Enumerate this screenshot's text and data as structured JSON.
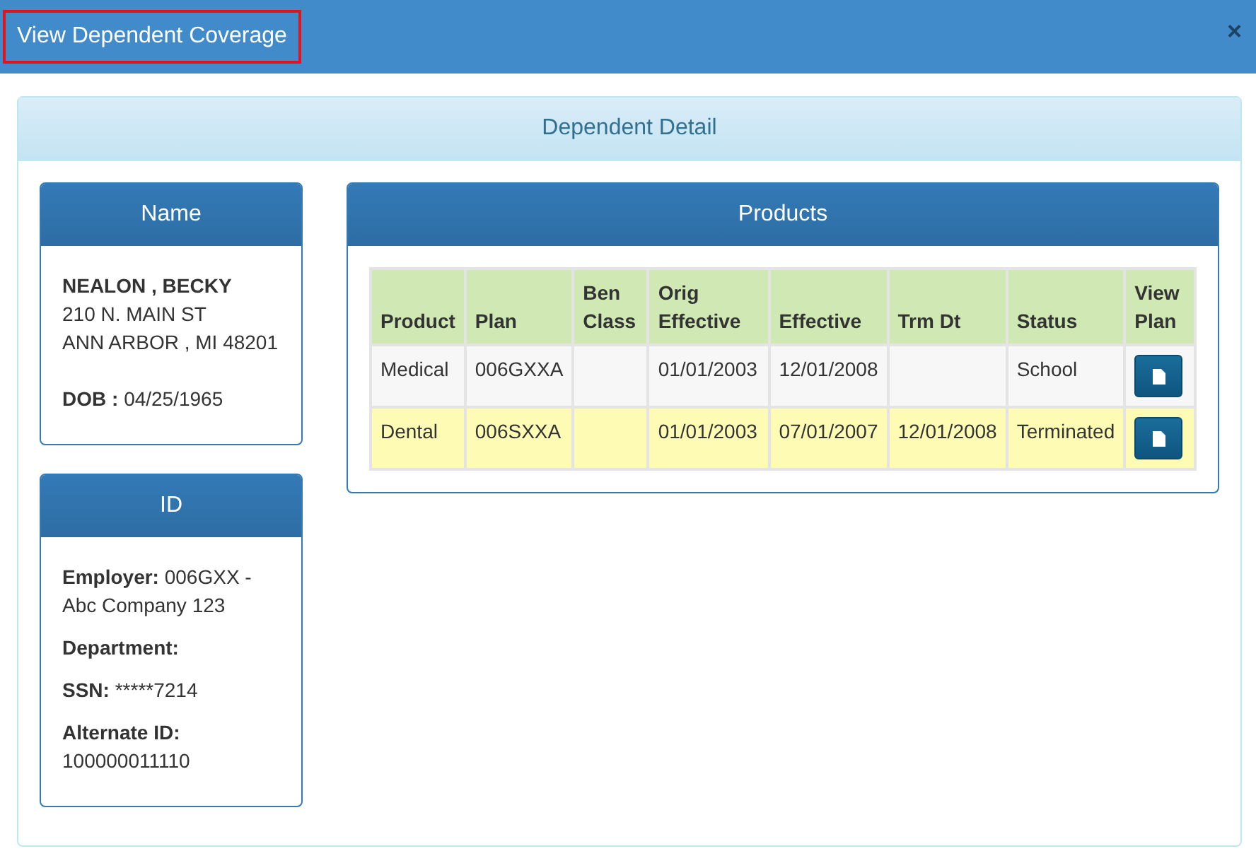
{
  "window": {
    "title": "View Dependent Coverage",
    "title_highlighted": true,
    "close": "×"
  },
  "panel": {
    "title": "Dependent Detail"
  },
  "name_card": {
    "title": "Name",
    "name": "NEALON , BECKY",
    "address": [
      "210 N. MAIN ST",
      "ANN ARBOR , MI 48201"
    ],
    "dob_label": "DOB :",
    "dob": "04/25/1965"
  },
  "id_card": {
    "title": "ID",
    "fields": [
      {
        "kind": "inline",
        "label": "Employer:",
        "value": "006GXX - Abc Company 123"
      },
      {
        "kind": "label",
        "label": "Department:"
      },
      {
        "kind": "inline",
        "label": "SSN:",
        "value": "*****7214"
      },
      {
        "kind": "stacked",
        "label": "Alternate ID:",
        "value": "100000011110"
      }
    ]
  },
  "products": {
    "title": "Products",
    "columns": [
      "Product",
      "Plan",
      "Ben Class",
      "Orig Effective",
      "Effective",
      "Trm Dt",
      "Status",
      "View Plan"
    ],
    "rows": [
      {
        "highlighted": false,
        "cells": [
          "Medical",
          "006GXXA",
          "",
          "01/01/2003",
          "12/01/2008",
          "",
          "School"
        ]
      },
      {
        "highlighted": true,
        "cells": [
          "Dental",
          "006SXXA",
          "",
          "01/01/2003",
          "07/01/2007",
          "12/01/2008",
          "Terminated"
        ]
      }
    ]
  }
}
